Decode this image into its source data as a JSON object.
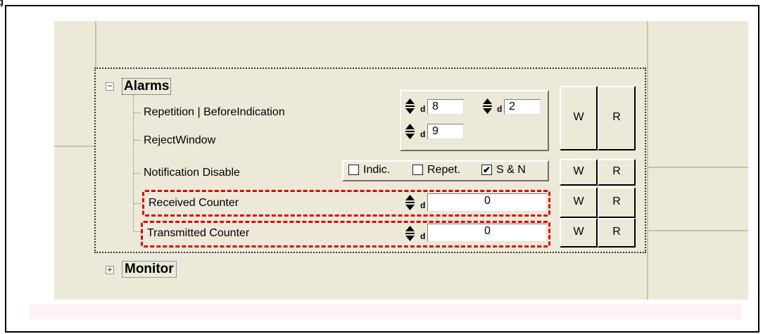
{
  "figure_label": "g",
  "alarms": {
    "heading": "Alarms",
    "toggle": "−",
    "rows": {
      "repetition": {
        "label": "Repetition  |  BeforeIndication",
        "value1": "8",
        "value2": "2"
      },
      "reject_window": {
        "label": "RejectWindow",
        "value": "9"
      },
      "notification": {
        "label": "Notification Disable",
        "checkboxes": [
          {
            "label": "Indic.",
            "checked": false
          },
          {
            "label": "Repet.",
            "checked": false
          },
          {
            "label": "S & N",
            "checked": true
          }
        ]
      },
      "received": {
        "label": "Received Counter",
        "value": "0"
      },
      "transmitted": {
        "label": "Transmitted Counter",
        "value": "0"
      }
    },
    "spinner_unit": "d",
    "write_label": "W",
    "read_label": "R"
  },
  "monitor": {
    "heading": "Monitor",
    "toggle": "+"
  },
  "colors": {
    "panel": "#ece9d8",
    "highlight": "#e00000",
    "band": "#fdf2f5"
  }
}
